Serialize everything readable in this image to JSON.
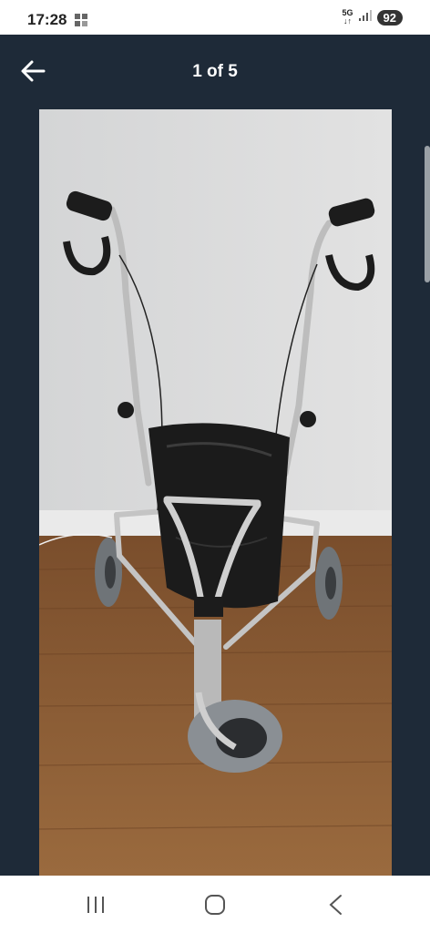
{
  "status_bar": {
    "time": "17:28",
    "network_top": "5G",
    "network_bottom": "↓↑",
    "battery": "92"
  },
  "app_bar": {
    "back_icon": "arrow-left-icon",
    "counter": "1 of 5"
  },
  "gallery": {
    "image_subject": "three-wheel walker rollator",
    "colors": {
      "background": "#1e2a38",
      "wall": "#dcdddd",
      "floor": "#8a5a32",
      "chrome": "#c4c4c4",
      "bag": "#1b1b1b"
    }
  },
  "nav_bar": {
    "recents_icon": "recents-icon",
    "home_icon": "home-icon",
    "back_icon": "nav-back-icon"
  }
}
